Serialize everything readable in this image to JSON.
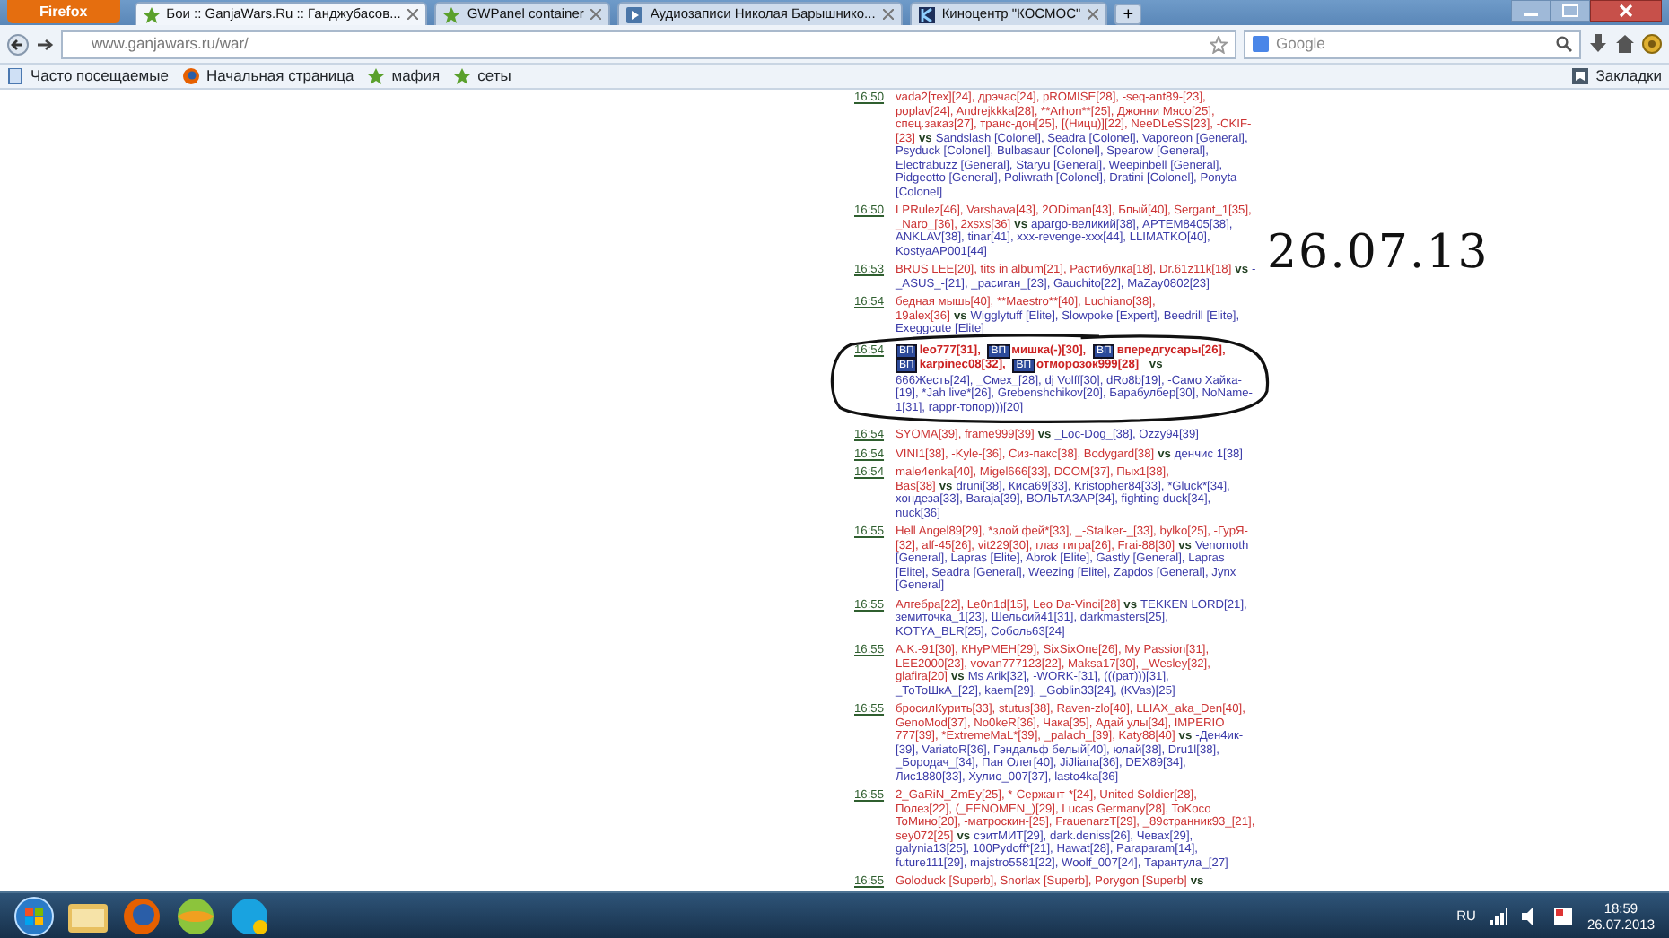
{
  "browser": {
    "menu_button": "Firefox",
    "tabs": [
      {
        "label": "Бои :: GanjaWars.Ru :: Ганджубасов...",
        "selected": true,
        "kind": "leaf"
      },
      {
        "label": "GWPanel container",
        "selected": false,
        "kind": "leaf"
      },
      {
        "label": "Аудиозаписи Николая Барышнико...",
        "selected": false,
        "kind": "play"
      },
      {
        "label": "Киноцентр \"КОСМОС\"",
        "selected": false,
        "kind": "k"
      }
    ],
    "new_tab": "+",
    "address": "www.ganjawars.ru/war/",
    "search_placeholder": "Google",
    "bookmarks": [
      {
        "label": "Часто посещаемые",
        "kind": "page"
      },
      {
        "label": "Начальная страница",
        "kind": "firefox"
      },
      {
        "label": "мафия",
        "kind": "leaf"
      },
      {
        "label": "сеты",
        "kind": "leaf"
      }
    ],
    "bookmarks_menu": "Закладки"
  },
  "battles": [
    {
      "time": "16:50",
      "team1": "vada2[тех][24], дрэчас[24], pROMISE[28], -seq-ant89-[23], poplav[24], Andrejkkka[28], **Arhon**[25], Джонни Мясо[25], спец.заказ[27], транс-дон[25], [(Ницц)][22], NeeDLeSS[23], -CKIF-[23]",
      "vs": "vs",
      "team2": "Sandslash [Colonel], Seadra [Colonel], Vaporeon [General], Psyduck [Colonel], Bulbasaur [Colonel], Spearow [General], Electrabuzz [General], Staryu [General], Weepinbell [General], Pidgeotto [General], Poliwrath [Colonel], Dratini [Colonel], Ponyta [Colonel]"
    },
    {
      "time": "16:50",
      "team1": "LPRulez[46], Varshava[43], 2ODiman[43], Бпый[40], Sergant_1[35], _Naro_[36], 2xsxs[36]",
      "vs": "vs",
      "team2": "apargo-великий[38], APTEM8405[38], ANKLAV[38], tinar[41], xxx-revenge-xxx[44], LLIMATKO[40], KostyaAP001[44]"
    },
    {
      "time": "16:53",
      "team1": "BRUS LEE[20], tits in album[21], Растибулка[18], Dr.61z11k[18]",
      "vs": "vs",
      "team2": "-_ASUS_-[21], _расиган_[23], Gauchito[22], MaZay0802[23]"
    },
    {
      "time": "16:54",
      "team1": "бедная мышь[40], **Maestro**[40], Luchiano[38], 19alex[36]",
      "vs": "vs",
      "team2": "Wigglytuff [Elite], Slowpoke [Expert], Beedrill [Elite], Exeggcute [Elite]"
    },
    {
      "time": "16:54",
      "circled": true,
      "team1_members": [
        {
          "badge": "ВП",
          "name": "leo777[31],"
        },
        {
          "badge": "ВП",
          "name": "мишка(-)[30],"
        },
        {
          "badge": "ВП",
          "name": "впередгусары[26],"
        },
        {
          "badge": "ВП",
          "name": "karpinec08[32],"
        },
        {
          "badge": "ВП",
          "name": "отморозок999[28]"
        }
      ],
      "vs": "vs",
      "team2": "666Жесть[24], _Смех_[28], dj Volff[30], dRo8b[19], -Само Хайка-[19], *Jah live*[26], Grebenshchikov[20], Барабулбер[30], NoName-1[31], rappr-топор)))[20]"
    },
    {
      "time": "16:54",
      "team1": "SYOMA[39], frame999[39]",
      "vs": "vs",
      "team2": "_Loc-Dog_[38], Ozzy94[39]"
    },
    {
      "time": "16:54",
      "team1": "VINI1[38], -Kyle-[36], Сиз-пакс[38], Bodygard[38]",
      "vs": "vs",
      "team2": "денчис 1[38]"
    },
    {
      "time": "16:54",
      "team1": "male4enka[40], Migel666[33], DCOM[37], Пых1[38], Bas[38]",
      "vs": "vs",
      "team2": "druni[38], Киса69[33], Kristopher84[33], *Gluck*[34], хондеза[33], Baraja[39], ВОЛЬТАЗАР[34], fighting duck[34], nuck[36]"
    },
    {
      "time": "16:55",
      "team1": "Hell Angel89[29], *злой фей*[33], _-Stalker-_[33], bylko[25], -ГурЯ-[32], alf-45[26], vit229[30], глаз тигра[26], Frai-88[30]",
      "vs": "vs",
      "team2": "Venomoth [General], Lapras [Elite], Abrok [Elite], Gastly [General], Lapras [Elite], Seadra [General], Weezing [Elite], Zapdos [General], Jynx [General]"
    },
    {
      "time": "16:55",
      "team1": "Алгебра[22], Le0n1d[15], Leo Da-Vinci[28]",
      "vs": "vs",
      "team2": "TEKKEN LORD[21], земиточка_1[23], Шельсий41[31], darkmasters[25], KOTYA_BLR[25], Соболь63[24]"
    },
    {
      "time": "16:55",
      "team1": "A.K.-91[30], КНуРМЕН[29], SixSixOne[26], My Passion[31], LEE2000[23], vovan777123[22], Maksa17[30], _Wesley[32], glafira[20]",
      "vs": "vs",
      "team2": "Ms Arik[32], -WORK-[31], (((рат)))[31], _ТоТоШкА_[22], kaem[29], _Goblin33[24], (KVas)[25]"
    },
    {
      "time": "16:55",
      "team1": "бросилКурить[33], stutus[38], Raven-zlo[40], LLIAX_aka_Den[40], GenoMod[37], No0keR[36], Чака[35], Адай улы[34], IMPERIO 777[39], *ExtremeMaL*[39], _palach_[39], Katy88[40]",
      "vs": "vs",
      "team2": "-Ден4ик-[39], VariatoR[36], Гэндальф белый[40], юлай[38], Dru1l[38], _Бородач_[34], Пан Олег[40], JiJliana[36], DEX89[34], Лис1880[33], Хулио_007[37], lasto4ka[36]"
    },
    {
      "time": "16:55",
      "team1": "2_GaRiN_ZmEy[25], *-Сержант-*[24], United Soldier[28], Полез[22], (_FENOMEN_)[29], Lucas Germany[28], ToKoco ToMино[20], -матроскин-[25], FrauenarzT[29], _89странник93_[21], sey072[25]",
      "vs": "vs",
      "team2": "сэитМИТ[29], dark.deniss[26], Чевах[29], galynia13[25], 100Pydoff*[21], Hawat[28], Paraparam[14], future111[29], majstro5581[22], Woolf_007[24], Тарантула_[27]"
    },
    {
      "time": "16:55",
      "team1": "Goloduck [Superb], Snorlax [Superb], Porygon [Superb]",
      "vs": "vs"
    }
  ],
  "annotation": {
    "text": "26.07.13"
  },
  "taskbar": {
    "language": "RU",
    "time": "18:59",
    "date": "26.07.2013"
  }
}
